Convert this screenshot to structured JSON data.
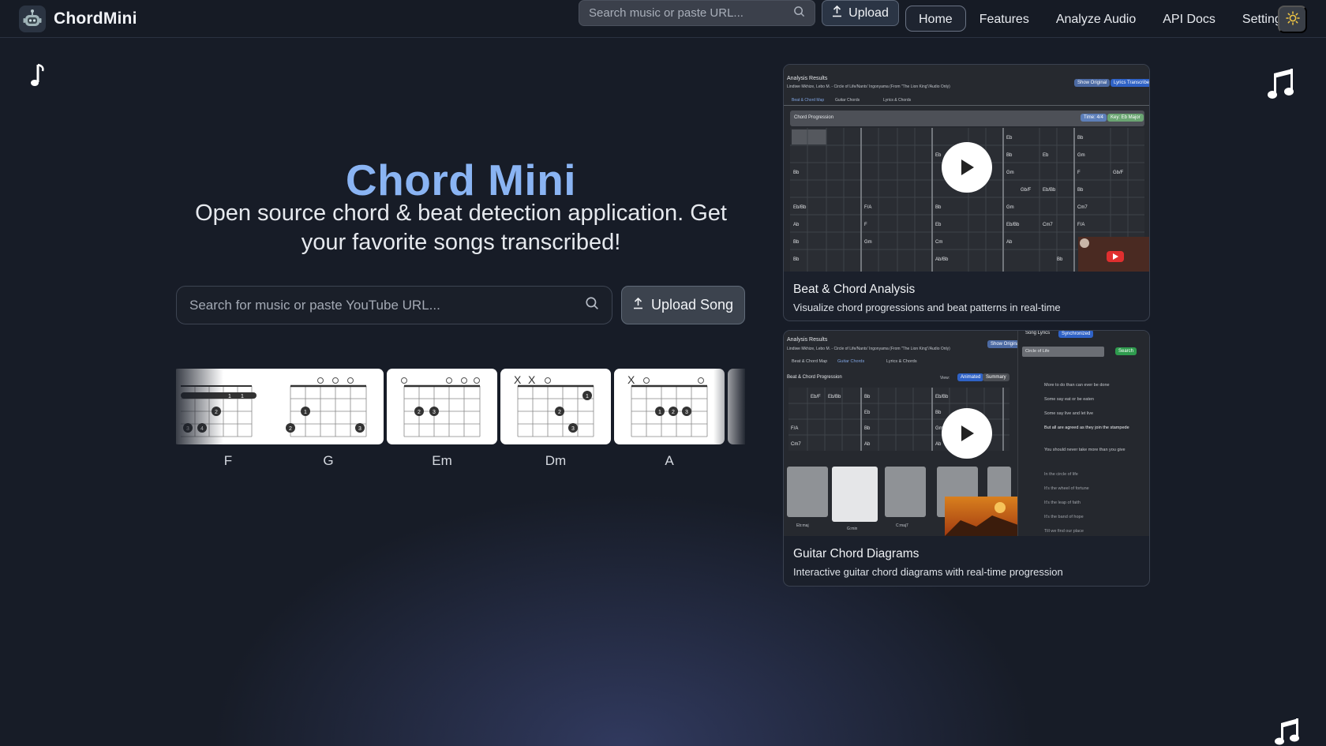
{
  "nav": {
    "brand": "ChordMini",
    "search_placeholder": "Search music or paste URL...",
    "upload_label": "Upload",
    "links": [
      {
        "label": "Home",
        "active": true
      },
      {
        "label": "Features",
        "active": false
      },
      {
        "label": "Analyze Audio",
        "active": false
      },
      {
        "label": "API Docs",
        "active": false
      },
      {
        "label": "Settings",
        "active": false
      }
    ],
    "theme_icon": "sun-icon"
  },
  "hero": {
    "title": "Chord Mini",
    "subtitle": "Open source chord & beat detection application. Get your favorite songs transcribed!",
    "search_placeholder": "Search for music or paste YouTube URL...",
    "upload_label": "Upload Song"
  },
  "chords": [
    {
      "name": "F"
    },
    {
      "name": "G"
    },
    {
      "name": "Em"
    },
    {
      "name": "Dm"
    },
    {
      "name": "A"
    }
  ],
  "features": [
    {
      "title": "Beat & Chord Analysis",
      "description": "Visualize chord progressions and beat patterns in real-time",
      "shot": {
        "header": "Analysis Results",
        "song": "Lindiwe Mkhize, Lebo M. - Circle of Life/Nants' Ingonyama (From \"The Lion King\"/Audio Only)",
        "tabs": [
          "Beat & Chord Map",
          "Guitar Chords",
          "Lyrics & Chords"
        ],
        "badges": [
          "Show Original",
          "Lyrics Transcribe"
        ],
        "panel_title": "Chord Progression",
        "panel_badges": [
          "Time: 4/4",
          "Key: Eb Major"
        ],
        "chords": [
          "Eb",
          "Bb",
          "Eb",
          "Gm",
          "Eb/Bb",
          "F/A",
          "Bb",
          "Cm7",
          "Ab",
          "F",
          "Eb/Bb",
          "Cm7",
          "Bb",
          "Gm",
          "Cm",
          "Ab/Bb"
        ]
      }
    },
    {
      "title": "Guitar Chord Diagrams",
      "description": "Interactive guitar chord diagrams with real-time progression",
      "shot": {
        "header": "Analysis Results",
        "song": "Lindiwe Mkhize, Lebo M. - Circle of Life/Nants' Ingonyama (From \"The Lion King\"/Audio Only)",
        "tabs": [
          "Beat & Chord Map",
          "Guitar Chords",
          "Lyrics & Chords"
        ],
        "badges": [
          "Show Original"
        ],
        "panel_title": "Beat & Chord Progression",
        "view_label": "View:",
        "view_options": [
          "Animated",
          "Summary"
        ],
        "lyrics_title": "Song Lyrics",
        "lyrics_badge": "Synchronized",
        "lyrics_search_value": "Circle of Life",
        "lyrics_search_button": "Search",
        "lyrics_lines": [
          "More to do than can ever be done",
          "Some say eat or be eaten",
          "Some say live and let live",
          "But all are agreed as they join the stampede",
          "You should never take more than you give",
          "In the circle of life",
          "It's the wheel of fortune",
          "It's the leap of faith",
          "It's the band of hope",
          "Till we find our place"
        ],
        "diagram_labels": [
          "Eb:maj",
          "G:min",
          "C:maj7"
        ]
      }
    }
  ]
}
